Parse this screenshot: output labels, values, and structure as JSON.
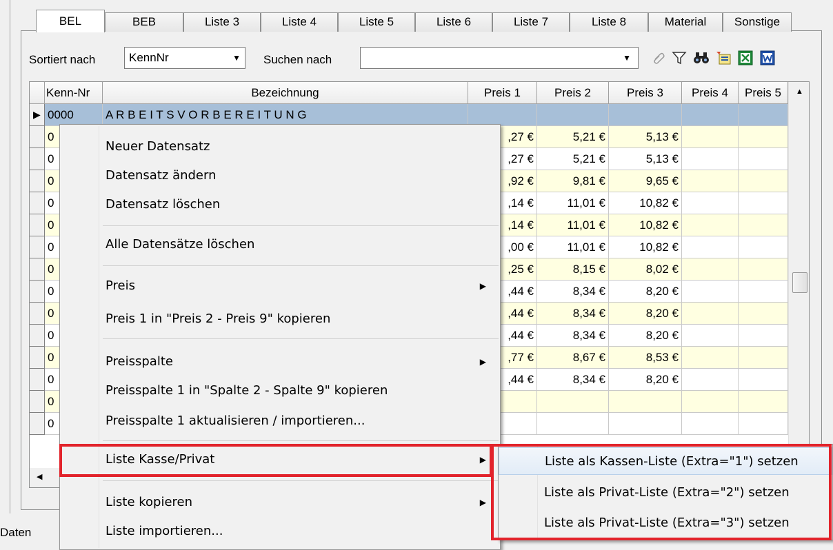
{
  "tabs": [
    "BEL",
    "BEB",
    "Liste 3",
    "Liste 4",
    "Liste 5",
    "Liste 6",
    "Liste 7",
    "Liste 8",
    "Material",
    "Sonstige"
  ],
  "toolbar": {
    "sort_label": "Sortiert nach",
    "sort_value": "KennNr",
    "search_label": "Suchen nach",
    "search_value": ""
  },
  "grid": {
    "columns": [
      "Kenn-Nr",
      "Bezeichnung",
      "Preis 1",
      "Preis 2",
      "Preis 3",
      "Preis 4",
      "Preis 5"
    ],
    "selected_row": {
      "kenn": "0000",
      "bezeichnung": "A R B E I T S V O R B E R E I T U N G"
    },
    "rows": [
      {
        "kenn": "0",
        "p1": ",27 €",
        "p2": "5,21 €",
        "p3": "5,13 €"
      },
      {
        "kenn": "0",
        "p1": ",27 €",
        "p2": "5,21 €",
        "p3": "5,13 €"
      },
      {
        "kenn": "0",
        "p1": ",92 €",
        "p2": "9,81 €",
        "p3": "9,65 €"
      },
      {
        "kenn": "0",
        "p1": ",14 €",
        "p2": "11,01 €",
        "p3": "10,82 €"
      },
      {
        "kenn": "0",
        "p1": ",14 €",
        "p2": "11,01 €",
        "p3": "10,82 €"
      },
      {
        "kenn": "0",
        "p1": ",00 €",
        "p2": "11,01 €",
        "p3": "10,82 €"
      },
      {
        "kenn": "0",
        "p1": ",25 €",
        "p2": "8,15 €",
        "p3": "8,02 €"
      },
      {
        "kenn": "0",
        "p1": ",44 €",
        "p2": "8,34 €",
        "p3": "8,20 €"
      },
      {
        "kenn": "0",
        "p1": ",44 €",
        "p2": "8,34 €",
        "p3": "8,20 €"
      },
      {
        "kenn": "0",
        "p1": ",44 €",
        "p2": "8,34 €",
        "p3": "8,20 €"
      },
      {
        "kenn": "0",
        "p1": ",77 €",
        "p2": "8,67 €",
        "p3": "8,53 €"
      },
      {
        "kenn": "0",
        "p1": ",44 €",
        "p2": "8,34 €",
        "p3": "8,20 €"
      },
      {
        "kenn": "0",
        "p1": "",
        "p2": "",
        "p3": ""
      },
      {
        "kenn": "0",
        "p1": "",
        "p2": "",
        "p3": ""
      }
    ]
  },
  "status": {
    "text": "Daten"
  },
  "context_menu": {
    "items": [
      {
        "label": "Neuer Datensatz"
      },
      {
        "label": "Datensatz ändern"
      },
      {
        "label": "Datensatz löschen"
      },
      {
        "label": "Alle Datensätze löschen"
      },
      {
        "label": "Preis",
        "submenu": true
      },
      {
        "label": "Preis 1 in \"Preis 2 - Preis 9\" kopieren"
      },
      {
        "label": "Preisspalte",
        "submenu": true
      },
      {
        "label": "Preisspalte 1 in \"Spalte 2 - Spalte 9\" kopieren"
      },
      {
        "label": "Preisspalte 1 aktualisieren / importieren..."
      },
      {
        "label": "Liste Kasse/Privat",
        "submenu": true
      },
      {
        "label": "Liste kopieren",
        "submenu": true
      },
      {
        "label": "Liste importieren..."
      }
    ]
  },
  "submenu": {
    "items": [
      {
        "label": "Liste als Kassen-Liste (Extra=\"1\") setzen"
      },
      {
        "label": "Liste als Privat-Liste (Extra=\"2\") setzen"
      },
      {
        "label": "Liste als Privat-Liste (Extra=\"3\") setzen"
      }
    ]
  },
  "colors": {
    "selected_row": "#a7bfd8",
    "odd_row": "#ffffe1",
    "highlight_red": "#e2232b"
  },
  "icons": [
    "paperclip-icon",
    "filter-icon",
    "binoculars-icon",
    "sort-icon",
    "excel-icon",
    "word-icon"
  ]
}
